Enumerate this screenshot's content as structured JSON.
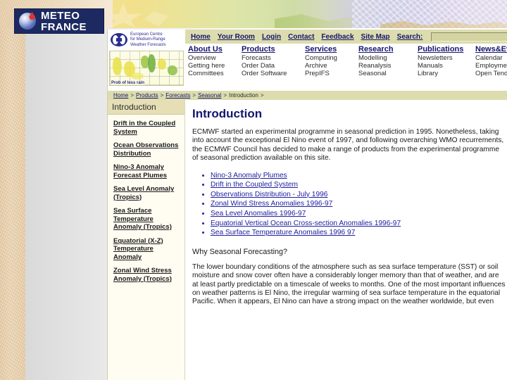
{
  "logo": {
    "brand_line1": "METEO",
    "brand_line2": "FRANCE"
  },
  "ecmwf": {
    "org_name": "European Centre for Medium-Range Weather Forecasts",
    "org_line1": "European Centre",
    "org_line2": "for Medium-Range",
    "org_line3": "Weather Forecasts",
    "map_caption": "Prob of less rain",
    "top_nav": [
      {
        "label": "Home"
      },
      {
        "label": "Your Room"
      },
      {
        "label": "Login"
      },
      {
        "label": "Contact"
      },
      {
        "label": "Feedback"
      },
      {
        "label": "Site Map"
      },
      {
        "label": "Search:"
      }
    ],
    "search": {
      "value": "",
      "placeholder": ""
    },
    "nav_columns": [
      {
        "heading": "About Us",
        "items": [
          "Overview",
          "Getting here",
          "Committees"
        ]
      },
      {
        "heading": "Products",
        "items": [
          "Forecasts",
          "Order Data",
          "Order Software"
        ]
      },
      {
        "heading": "Services",
        "items": [
          "Computing",
          "Archive",
          "PrepIFS"
        ]
      },
      {
        "heading": "Research",
        "items": [
          "Modelling",
          "Reanalysis",
          "Seasonal"
        ]
      },
      {
        "heading": "Publications",
        "items": [
          "Newsletters",
          "Manuals",
          "Library"
        ]
      },
      {
        "heading": "News&Events",
        "items": [
          "Calendar",
          "Employment",
          "Open Tenders"
        ]
      }
    ],
    "breadcrumb": [
      {
        "label": "Home",
        "link": true
      },
      {
        "label": "Products",
        "link": true
      },
      {
        "label": "Forecasts",
        "link": true
      },
      {
        "label": "Seasonal",
        "link": true
      },
      {
        "label": "Introduction",
        "link": false
      }
    ],
    "breadcrumb_separator": ">",
    "sidebar": {
      "heading": "Introduction",
      "items": [
        "Drift in the Coupled System",
        "Ocean Observations Distribution",
        "Nino-3 Anomaly Forecast Plumes",
        "Sea Level Anomaly (Tropics)",
        "Sea Surface Temperature Anomaly (Tropics)",
        "Equatorial (X-Z) Temperature Anomaly",
        "Zonal Wind Stress Anomaly (Tropics)"
      ]
    },
    "main": {
      "title": "Introduction",
      "intro_paragraph": "ECMWF started an experimental programme in seasonal prediction in 1995. Nonetheless, taking into account the exceptional El Nino event of 1997, and following overarching WMO recurrements, the ECMWF Council has decided to make a range of products from the experimental programme of seasonal prediction available on this site.",
      "links": [
        "Nino-3 Anomaly Plumes",
        "Drift in the Coupled System",
        "Observations Distribution - July 1996",
        "Zonal Wind Stress Anomalies 1996-97",
        "Sea Level Anomalies 1996-97",
        "Equatorial Vertical Ocean Cross-section Anomalies 1996-97",
        "Sea Surface Temperature Anomalies 1996 97"
      ],
      "subheading": "Why Seasonal Forecasting?",
      "body_paragraph": "The lower boundary conditions of the atmosphere such as sea surface temperature (SST) or soil moisture and snow cover often have a considerably longer memory than that of weather, and are at least partly predictable on a timescale of weeks to months. One of the most important influences on weather patterns is El Nino, the irregular warming of sea surface temperature in the equatorial Pacific. When it appears, El Nino can have a strong impact on the weather worldwide, but even"
    }
  },
  "colors": {
    "nav_band": "#dcdcae",
    "link_blue": "#15156e",
    "body_link": "#2020a0",
    "sidebar_head": "#e6dfb6",
    "mf_navy": "#1d2a62"
  }
}
